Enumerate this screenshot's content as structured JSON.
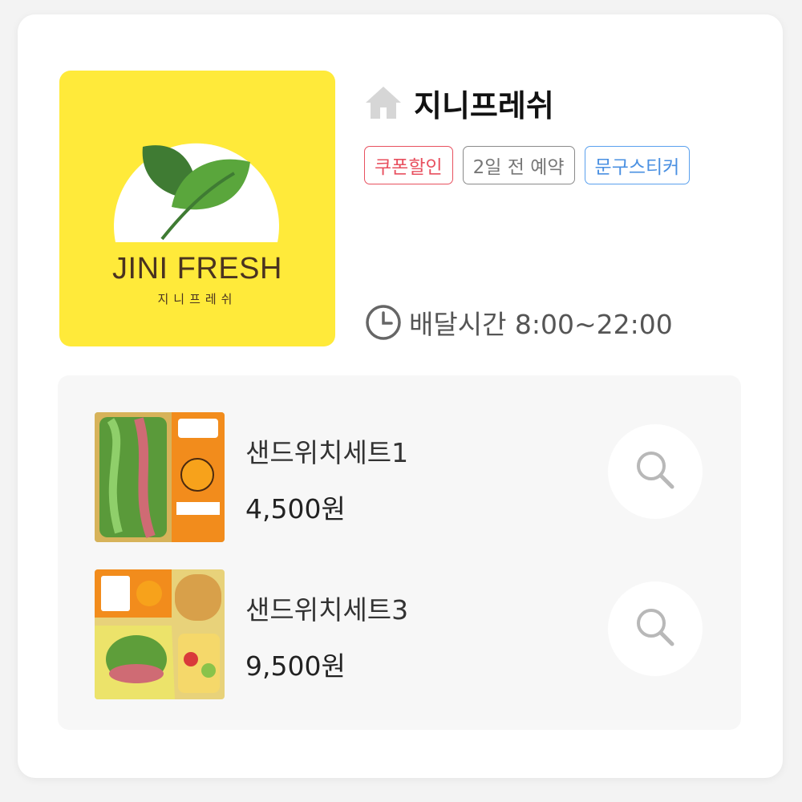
{
  "store": {
    "name": "지니프레쉬",
    "logo_text_en": "JINI FRESH",
    "logo_text_ko": "지니프레쉬",
    "home_icon": "home-icon"
  },
  "tags": [
    {
      "label": "쿠폰할인",
      "color": "#e8505f"
    },
    {
      "label": "2일 전 예약",
      "color": "#8a8a8a"
    },
    {
      "label": "문구스티커",
      "color": "#4a90e2"
    }
  ],
  "delivery": {
    "icon": "clock-icon",
    "text": "배달시간 8:00~22:00"
  },
  "menu": {
    "items": [
      {
        "name": "샌드위치세트1",
        "price": "4,500원",
        "action_icon": "search-icon"
      },
      {
        "name": "샌드위치세트3",
        "price": "9,500원",
        "action_icon": "search-icon"
      }
    ]
  },
  "colors": {
    "logo_background": "#ffea3a",
    "leaf_dark": "#3f7b33",
    "leaf_light": "#5aa63c",
    "logo_text": "#4a3320"
  }
}
